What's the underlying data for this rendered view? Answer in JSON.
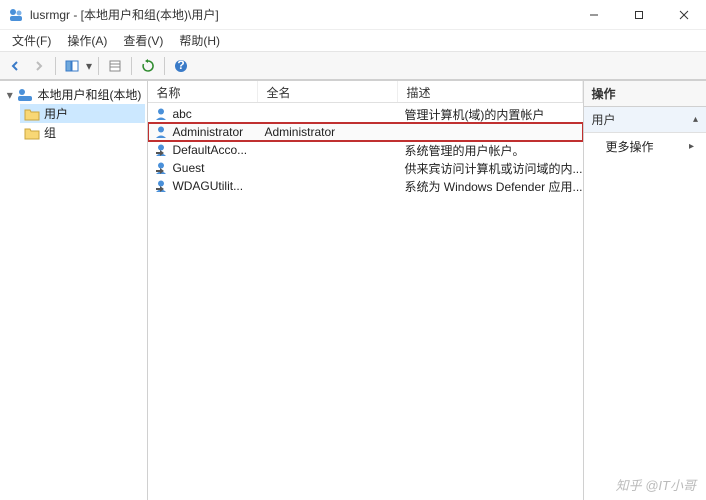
{
  "window": {
    "title": "lusrmgr - [本地用户和组(本地)\\用户]"
  },
  "menu": {
    "file": "文件(F)",
    "action": "操作(A)",
    "view": "查看(V)",
    "help": "帮助(H)"
  },
  "tree": {
    "root": "本地用户和组(本地)",
    "users": "用户",
    "groups": "组"
  },
  "columns": {
    "name": "名称",
    "fullname": "全名",
    "description": "描述"
  },
  "rows": [
    {
      "name": "abc",
      "fullname": "",
      "description": "管理计算机(域)的内置帐户",
      "highlighted": false,
      "disabled": false
    },
    {
      "name": "Administrator",
      "fullname": "Administrator",
      "description": "",
      "highlighted": true,
      "disabled": false
    },
    {
      "name": "DefaultAcco...",
      "fullname": "",
      "description": "系统管理的用户帐户。",
      "highlighted": false,
      "disabled": true
    },
    {
      "name": "Guest",
      "fullname": "",
      "description": "供来宾访问计算机或访问域的内...",
      "highlighted": false,
      "disabled": true
    },
    {
      "name": "WDAGUtilit...",
      "fullname": "",
      "description": "系统为 Windows Defender 应用...",
      "highlighted": false,
      "disabled": true
    }
  ],
  "actions": {
    "header": "操作",
    "section": "用户",
    "more": "更多操作"
  },
  "watermark": "知乎 @IT小哥"
}
